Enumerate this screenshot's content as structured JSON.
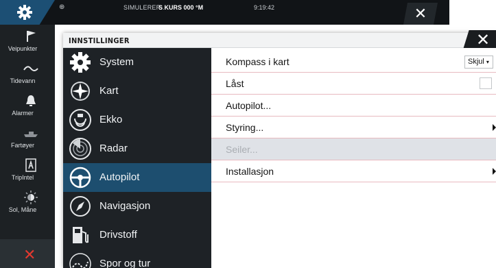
{
  "statusbar": {
    "globe_icon": "globe-icon",
    "sim_text": "SIMULERER...",
    "course_text": "S KURS 000 °M",
    "time": "9:19:42",
    "gear_icon": "gear-icon",
    "close_icon": "close-icon"
  },
  "sidebar": {
    "items": [
      {
        "label": "Veipunkter",
        "icon": "flag-icon"
      },
      {
        "label": "Tidevann",
        "icon": "tide-wave-icon"
      },
      {
        "label": "Alarmer",
        "icon": "bell-icon"
      },
      {
        "label": "Fartøyer",
        "icon": "vessel-icon"
      },
      {
        "label": "TripIntel",
        "icon": "tripintel-icon"
      },
      {
        "label": "Sol, Måne",
        "icon": "sun-moon-icon"
      }
    ],
    "close_icon": "close-icon"
  },
  "dialog": {
    "title": "INNSTILLINGER",
    "close_icon": "close-icon",
    "categories": [
      {
        "label": "System",
        "icon": "gear-icon"
      },
      {
        "label": "Kart",
        "icon": "chart-compass-icon"
      },
      {
        "label": "Ekko",
        "icon": "echo-sonar-icon"
      },
      {
        "label": "Radar",
        "icon": "radar-icon"
      },
      {
        "label": "Autopilot",
        "icon": "steering-wheel-icon",
        "selected": true
      },
      {
        "label": "Navigasjon",
        "icon": "navigation-compass-icon"
      },
      {
        "label": "Drivstoff",
        "icon": "fuel-pump-icon"
      },
      {
        "label": "Spor og tur",
        "icon": "trail-icon"
      }
    ],
    "settings": [
      {
        "label": "Kompass i kart",
        "control": "select",
        "value": "Skjul"
      },
      {
        "label": "Låst",
        "control": "checkbox",
        "checked": false
      },
      {
        "label": "Autopilot...",
        "control": "none"
      },
      {
        "label": "Styring...",
        "control": "submenu"
      },
      {
        "label": "Seiler...",
        "control": "none",
        "disabled": true
      },
      {
        "label": "Installasjon",
        "control": "submenu"
      }
    ]
  },
  "colors": {
    "accent": "#1d4e6f",
    "sidebar_bg": "#1d2124",
    "close_red": "#e3392f",
    "row_separator": "#e8b9bf"
  }
}
